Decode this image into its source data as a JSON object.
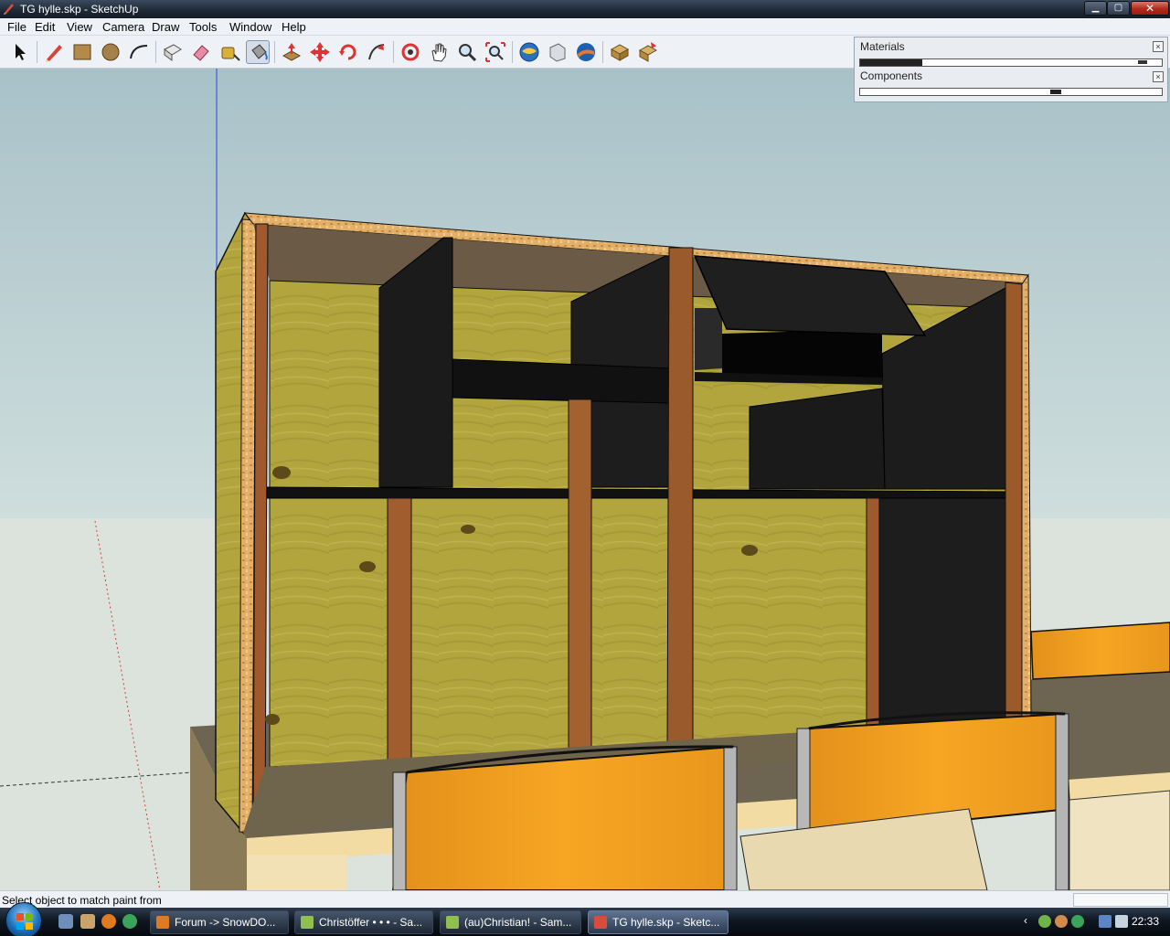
{
  "window": {
    "title": "TG hylle.skp - SketchUp"
  },
  "menu": [
    "File",
    "Edit",
    "View",
    "Camera",
    "Draw",
    "Tools",
    "Window",
    "Help"
  ],
  "toolbar": {
    "tools": [
      {
        "name": "select-tool-icon",
        "active": false
      },
      {
        "name": "pencil-line-tool-icon",
        "active": false
      },
      {
        "name": "rectangle-tool-icon",
        "active": false
      },
      {
        "name": "circle-tool-icon",
        "active": false
      },
      {
        "name": "arc-tool-icon",
        "active": false
      },
      {
        "name": "make-component-icon",
        "active": false
      },
      {
        "name": "eraser-tool-icon",
        "active": false
      },
      {
        "name": "tape-measure-tool-icon",
        "active": false
      },
      {
        "name": "paint-bucket-tool-icon",
        "active": true
      },
      {
        "name": "push-pull-tool-icon",
        "active": false
      },
      {
        "name": "move-tool-icon",
        "active": false
      },
      {
        "name": "rotate-tool-icon",
        "active": false
      },
      {
        "name": "follow-me-tool-icon",
        "active": false
      },
      {
        "name": "orbit-tool-icon",
        "active": false
      },
      {
        "name": "pan-tool-icon",
        "active": false
      },
      {
        "name": "zoom-tool-icon",
        "active": false
      },
      {
        "name": "zoom-extents-tool-icon",
        "active": false
      },
      {
        "name": "get-models-icon",
        "active": false
      },
      {
        "name": "share-model-icon",
        "active": false
      },
      {
        "name": "google-earth-icon",
        "active": false
      },
      {
        "name": "components-icon",
        "active": false
      },
      {
        "name": "share-component-icon",
        "active": false
      }
    ]
  },
  "trays": {
    "materials": "Materials",
    "components": "Components"
  },
  "status": {
    "text": "Select object to match paint from"
  },
  "taskbar": {
    "tasks": [
      {
        "label": "Forum -> SnowDO...",
        "active": false
      },
      {
        "label": "Christöffer • • • - Sa...",
        "active": false
      },
      {
        "label": "(au)Christian! - Sam...",
        "active": false
      },
      {
        "label": "TG hylle.skp - Sketc...",
        "active": true
      }
    ],
    "clock": "22:33"
  },
  "colors": {
    "plywood": "#b5a740",
    "dark_panel": "#1c1c1c",
    "wood_strip": "#9a5a2e",
    "chair_orange": "#f0a020",
    "sky": "#bcd1d4",
    "ground": "#dbe3dc"
  }
}
